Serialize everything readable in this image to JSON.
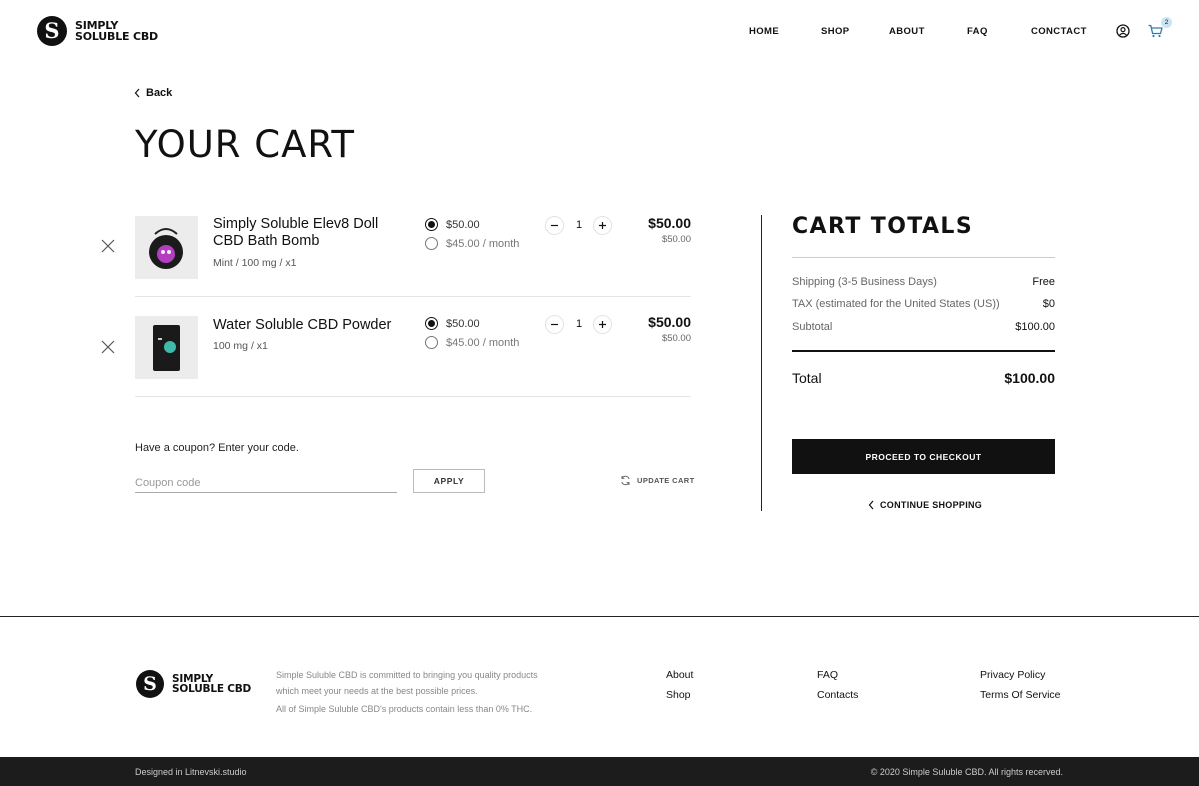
{
  "brand": {
    "line1": "SIMPLY",
    "line2": "SOLUBLE CBD",
    "mark": "S"
  },
  "nav": {
    "home": "HOME",
    "shop": "SHOP",
    "about": "ABOUT",
    "faq": "FAQ",
    "contact": "CONCTACT",
    "account_icon": "user-circle-icon",
    "cart_icon": "cart-icon",
    "cart_count": "2"
  },
  "back_label": "Back",
  "title": "YOUR CART",
  "items": [
    {
      "name": "Simply Soluble Elev8 Doll CBD Bath Bomb",
      "meta": "Mint / 100 mg / x1",
      "option_once": "$50.00",
      "option_sub": "$45.00 / month",
      "qty": "1",
      "price": "$50.00",
      "unit_price": "$50.00"
    },
    {
      "name": "Water Soluble CBD Powder",
      "meta": "100 mg / x1",
      "option_once": "$50.00",
      "option_sub": "$45.00 / month",
      "qty": "1",
      "price": "$50.00",
      "unit_price": "$50.00"
    }
  ],
  "coupon": {
    "question": "Have a coupon? Enter your code.",
    "placeholder": "Coupon code",
    "apply": "APPLY",
    "update": "UPDATE CART"
  },
  "totals": {
    "title": "CART TOTALS",
    "shipping_label": "Shipping (3-5 Business Days)",
    "shipping_value": "Free",
    "tax_label": "TAX (estimated for the United States (US))",
    "tax_value": "$0",
    "subtotal_label": "Subtotal",
    "subtotal_value": "$100.00",
    "total_label": "Total",
    "total_value": "$100.00",
    "checkout": "PROCEED TO CHECKOUT",
    "continue": "CONTINUE SHOPPING"
  },
  "footer": {
    "description": "Simple Suluble CBD is committed to bringing you quality products which meet your needs at the best possible prices.",
    "thc_note": "All of Simple Suluble CBD's products contain less than 0% THC.",
    "about": "About",
    "shop": "Shop",
    "faq": "FAQ",
    "contacts": "Contacts",
    "privacy": "Privacy Policy",
    "terms": "Terms Of Service",
    "designed": "Designed in Litnevski.studio",
    "copyright": "© 2020 Simple Suluble CBD. All rights recerved."
  }
}
